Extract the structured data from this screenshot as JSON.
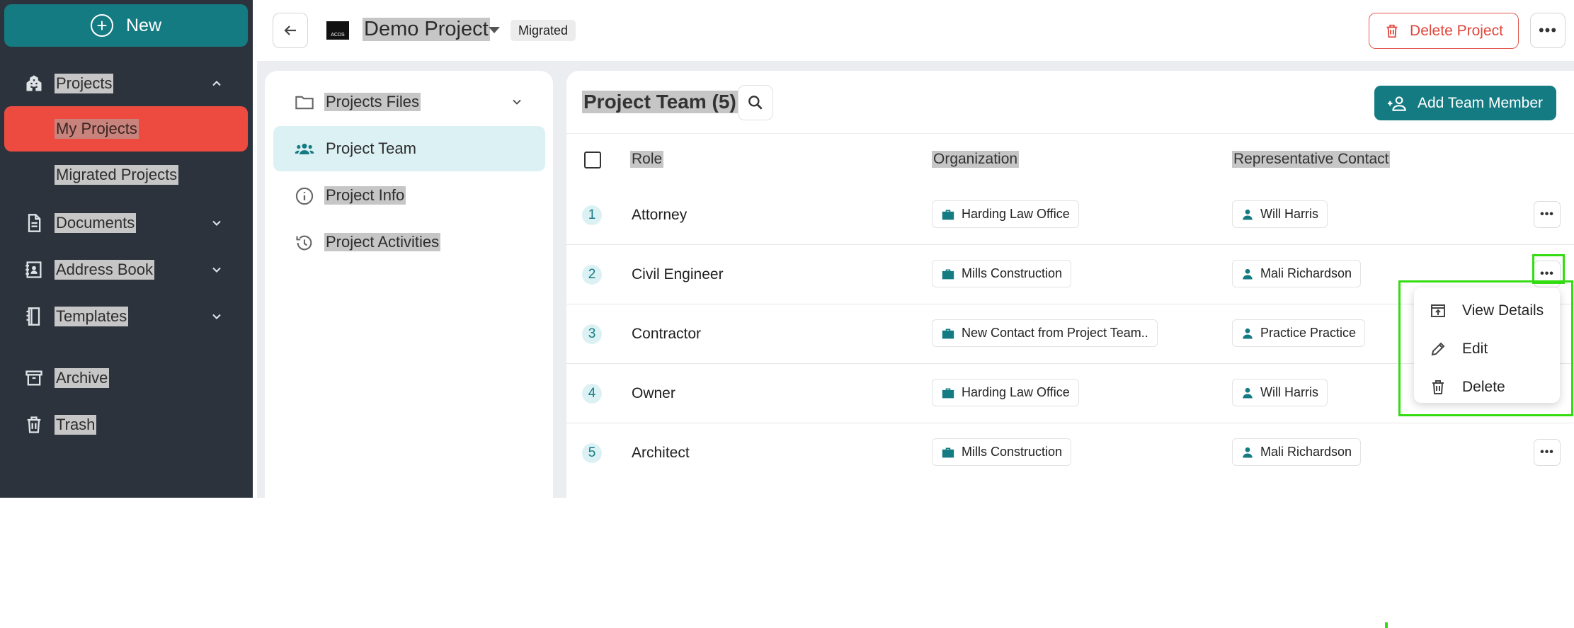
{
  "sidebar": {
    "new_label": "New",
    "items": [
      {
        "label": "Projects",
        "icon": "building-icon",
        "expanded": true
      },
      {
        "label": "Documents",
        "icon": "document-icon"
      },
      {
        "label": "Address Book",
        "icon": "address-book-icon"
      },
      {
        "label": "Templates",
        "icon": "templates-icon"
      },
      {
        "label": "Archive",
        "icon": "archive-icon"
      },
      {
        "label": "Trash",
        "icon": "trash-icon"
      }
    ],
    "sub_items": [
      {
        "label": "My Projects",
        "active": true
      },
      {
        "label": "Migrated Projects"
      }
    ],
    "colors": {
      "bg": "#2c333d",
      "active": "#ee4b40",
      "accent": "#157b83"
    }
  },
  "header": {
    "logo_text": "ACDS",
    "project_title": "Demo Project",
    "badge": "Migrated",
    "delete_label": "Delete Project"
  },
  "project_nav": {
    "items": [
      {
        "label": "Projects Files",
        "icon": "folder-icon"
      },
      {
        "label": "Project Team",
        "icon": "team-icon",
        "active": true
      },
      {
        "label": "Project Info",
        "icon": "info-icon"
      },
      {
        "label": "Project Activities",
        "icon": "history-icon"
      }
    ]
  },
  "team": {
    "title": "Project Team (5)",
    "add_label": "Add Team Member",
    "columns": [
      "Role",
      "Organization",
      "Representative Contact"
    ],
    "rows": [
      {
        "num": "1",
        "role": "Attorney",
        "org": "Harding Law Office",
        "contact": "Will Harris"
      },
      {
        "num": "2",
        "role": "Civil Engineer",
        "org": "Mills Construction",
        "contact": "Mali Richardson"
      },
      {
        "num": "3",
        "role": "Contractor",
        "org": "New Contact from Project Team..",
        "contact": "Practice Practice"
      },
      {
        "num": "4",
        "role": "Owner",
        "org": "Harding Law Office",
        "contact": "Will Harris"
      },
      {
        "num": "5",
        "role": "Architect",
        "org": "Mills Construction",
        "contact": "Mali Richardson"
      }
    ]
  },
  "context_menu": {
    "items": [
      {
        "label": "View Details",
        "icon": "open-in-new-icon"
      },
      {
        "label": "Edit",
        "icon": "pencil-icon"
      },
      {
        "label": "Delete",
        "icon": "trash-icon"
      }
    ]
  }
}
